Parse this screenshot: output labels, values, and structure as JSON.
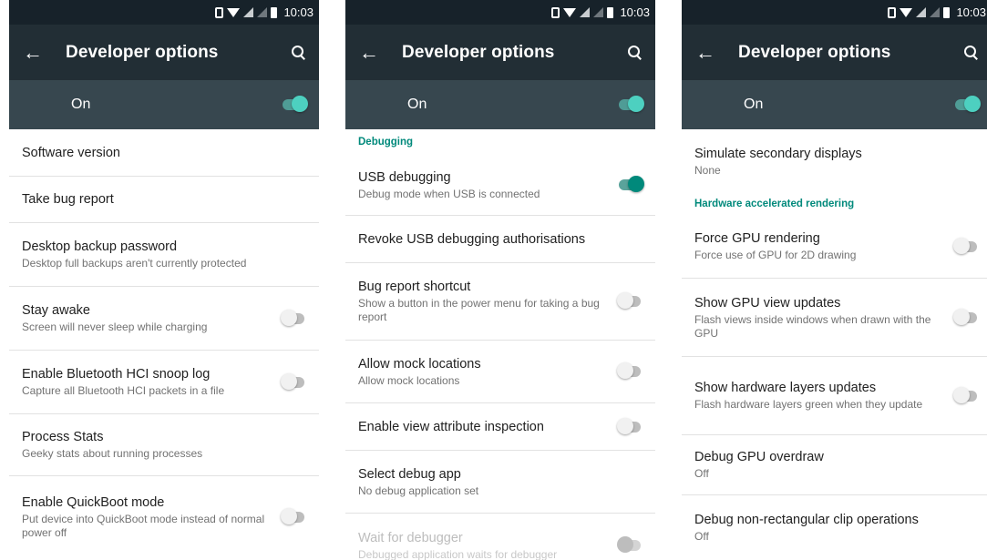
{
  "status_time": "10:03",
  "app_bar_title": "Developer options",
  "master_switch_label": "On",
  "screens": [
    {
      "items": [
        {
          "title": "Software version",
          "summary": ""
        },
        {
          "title": "Take bug report",
          "summary": ""
        },
        {
          "title": "Desktop backup password",
          "summary": "Desktop full backups aren't currently protected"
        },
        {
          "title": "Stay awake",
          "summary": "Screen will never sleep while charging",
          "toggle": "off"
        },
        {
          "title": "Enable Bluetooth HCI snoop log",
          "summary": "Capture all Bluetooth HCI packets in a file",
          "toggle": "off"
        },
        {
          "title": "Process Stats",
          "summary": "Geeky stats about running processes"
        },
        {
          "title": "Enable QuickBoot mode",
          "summary": "Put device into QuickBoot mode instead of normal power off",
          "toggle": "off"
        }
      ]
    },
    {
      "category": "Debugging",
      "items": [
        {
          "title": "USB debugging",
          "summary": "Debug mode when USB is connected",
          "toggle": "on"
        },
        {
          "title": "Revoke USB debugging authorisations",
          "summary": ""
        },
        {
          "title": "Bug report shortcut",
          "summary": "Show a button in the power menu for taking a bug report",
          "toggle": "off"
        },
        {
          "title": "Allow mock locations",
          "summary": "Allow mock locations",
          "toggle": "off"
        },
        {
          "title": "Enable view attribute inspection",
          "summary": "",
          "toggle": "off"
        },
        {
          "title": "Select debug app",
          "summary": "No debug application set"
        },
        {
          "title": "Wait for debugger",
          "summary": "Debugged application waits for debugger",
          "toggle": "disabled"
        }
      ]
    },
    {
      "items": [
        {
          "title": "Simulate secondary displays",
          "summary": "None"
        }
      ],
      "category": "Hardware accelerated rendering",
      "items_after": [
        {
          "title": "Force GPU rendering",
          "summary": "Force use of GPU for 2D drawing",
          "toggle": "off"
        },
        {
          "title": "Show GPU view updates",
          "summary": "Flash views inside windows when drawn with the GPU",
          "toggle": "off"
        },
        {
          "title": "Show hardware layers updates",
          "summary": "Flash hardware layers green when they update",
          "toggle": "off"
        },
        {
          "title": "Debug GPU overdraw",
          "summary": "Off"
        },
        {
          "title": "Debug non-rectangular clip operations",
          "summary": "Off"
        }
      ]
    }
  ]
}
